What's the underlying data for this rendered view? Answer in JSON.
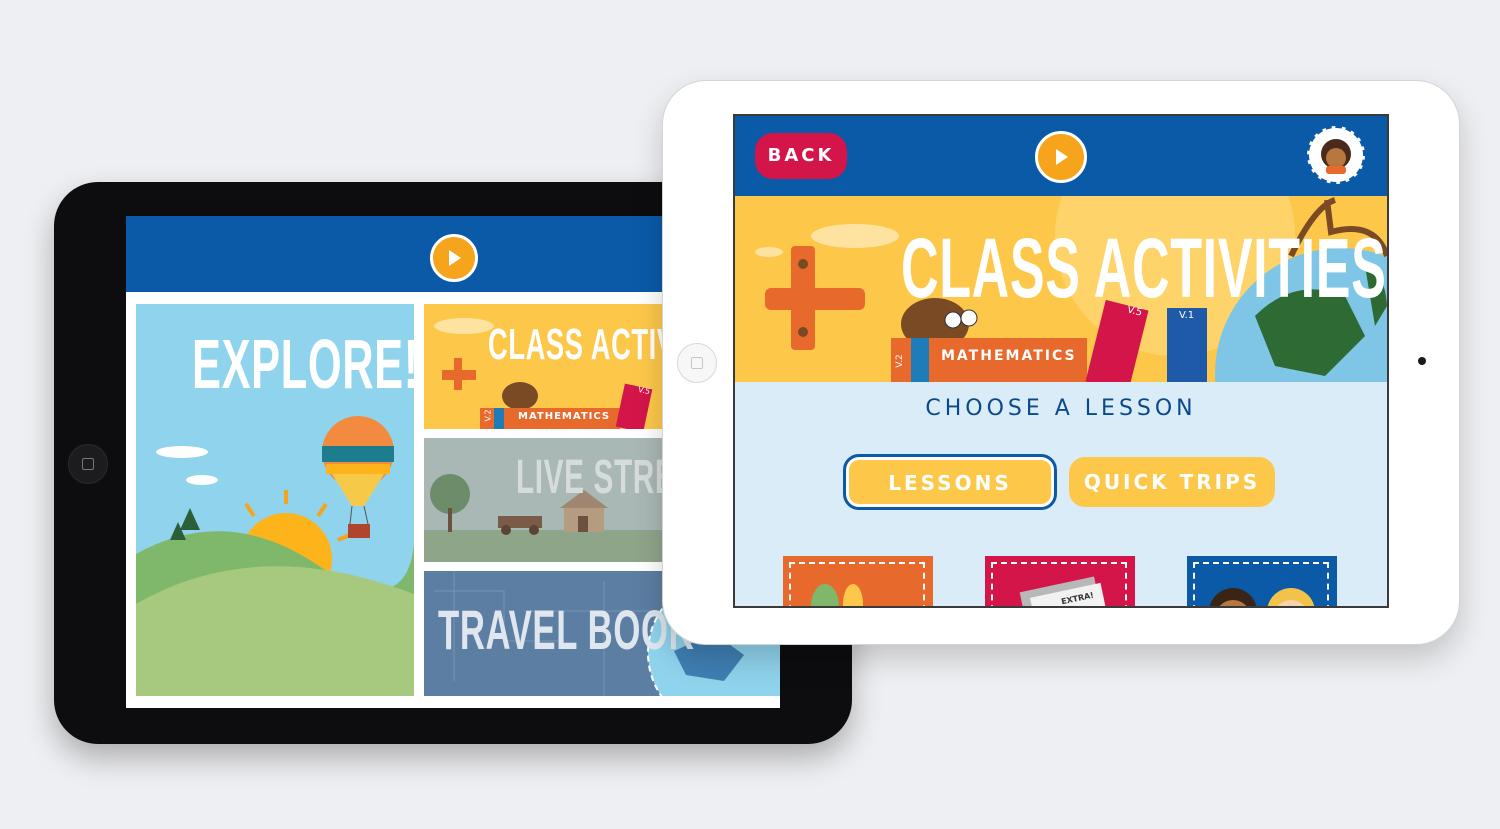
{
  "left_tablet": {
    "tiles": {
      "explore": "EXPLORE!",
      "class_activities": "CLASS ACTIVITI",
      "class_activities_book": "MATHEMATICS",
      "book_version_a": "V.2",
      "book_version_b": "V.5",
      "live_stream": "LIVE STREA",
      "travel_book": "TRAVEL BOOK"
    }
  },
  "right_tablet": {
    "header": {
      "back_label": "BACK"
    },
    "banner": {
      "title": "CLASS ACTIVITIES",
      "book_label": "MATHEMATICS",
      "book_version_a": "V.2",
      "book_version_b": "V.5",
      "book_version_c": "V.1"
    },
    "choose_label": "CHOOSE A LESSON",
    "tabs": [
      {
        "label": "LESSONS"
      },
      {
        "label": "QUICK TRIPS"
      }
    ],
    "cards": [
      {
        "color": "#e8692c"
      },
      {
        "color": "#d4154a",
        "text": "EXTRA!"
      },
      {
        "color": "#0a5aa7"
      }
    ]
  },
  "colors": {
    "brand_blue": "#0a5aa7",
    "accent_yellow": "#fdc84a",
    "back_red": "#d4154a",
    "sky": "#8fd3ec"
  }
}
